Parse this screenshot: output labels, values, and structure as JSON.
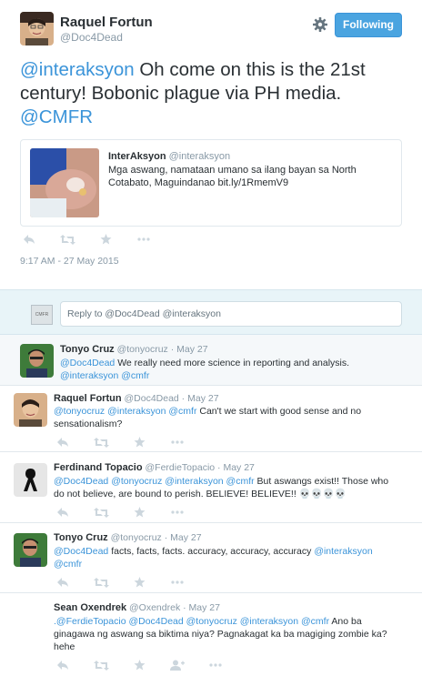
{
  "main_tweet": {
    "author_name": "Raquel Fortun",
    "author_handle": "@Doc4Dead",
    "follow_label": "Following",
    "text_parts": {
      "m1": "@interaksyon",
      "t1": " Oh come on this is the 21st century! Bobonic plague via PH media. ",
      "m2": "@CMFR"
    },
    "card": {
      "name": "InterAksyon",
      "handle": "@interaksyon",
      "text": "Mga aswang, namataan umano sa ilang bayan sa North Cotabato, Maguindanao bit.ly/1RmemV9"
    },
    "timestamp": "9:17 AM - 27 May 2015"
  },
  "reply_box": {
    "avatar_label": "CMFR",
    "placeholder": "Reply to @Doc4Dead @interaksyon"
  },
  "replies": [
    {
      "name": "Tonyo Cruz",
      "handle": "@tonyocruz",
      "date": "May 27",
      "mentions_a": "@Doc4Dead",
      "text_a": " We really need more science in reporting and analysis.",
      "mentions_b": "@interaksyon @cmfr",
      "text_b": ""
    },
    {
      "name": "Raquel Fortun",
      "handle": "@Doc4Dead",
      "date": "May 27",
      "mentions_a": "@tonyocruz @interaksyon @cmfr",
      "text_a": " Can't we start with good sense and no sensationalism?"
    },
    {
      "name": "Ferdinand Topacio",
      "handle": "@FerdieTopacio",
      "date": "May 27",
      "mentions_a": "@Doc4Dead @tonyocruz @interaksyon @cmfr",
      "text_a": " But aswangs exist!! Those who do not believe, are bound to perish. BELIEVE! BELIEVE!! 💀💀💀💀"
    },
    {
      "name": "Tonyo Cruz",
      "handle": "@tonyocruz",
      "date": "May 27",
      "mentions_a": "@Doc4Dead",
      "text_a": " facts, facts, facts. accuracy, accuracy, accuracy  ",
      "mentions_b": "@interaksyon @cmfr"
    },
    {
      "name": "Sean Oxendrek",
      "handle": "@Oxendrek",
      "date": "May 27",
      "prefix": ".",
      "mentions_a": "@FerdieTopacio @Doc4Dead @tonyocruz @interaksyon @cmfr",
      "text_a": " Ano ba ginagawa ng aswang sa biktima niya? Pagnakagat ka ba magiging zombie ka? hehe"
    }
  ],
  "colors": {
    "link": "#3b94d9",
    "follow_button": "#4aa4e0",
    "muted": "#8899a6",
    "reply_bg": "#e8f4f8"
  },
  "icons": [
    "reply-icon",
    "retweet-icon",
    "favorite-icon",
    "more-icon",
    "gear-icon",
    "follow-user-icon"
  ]
}
